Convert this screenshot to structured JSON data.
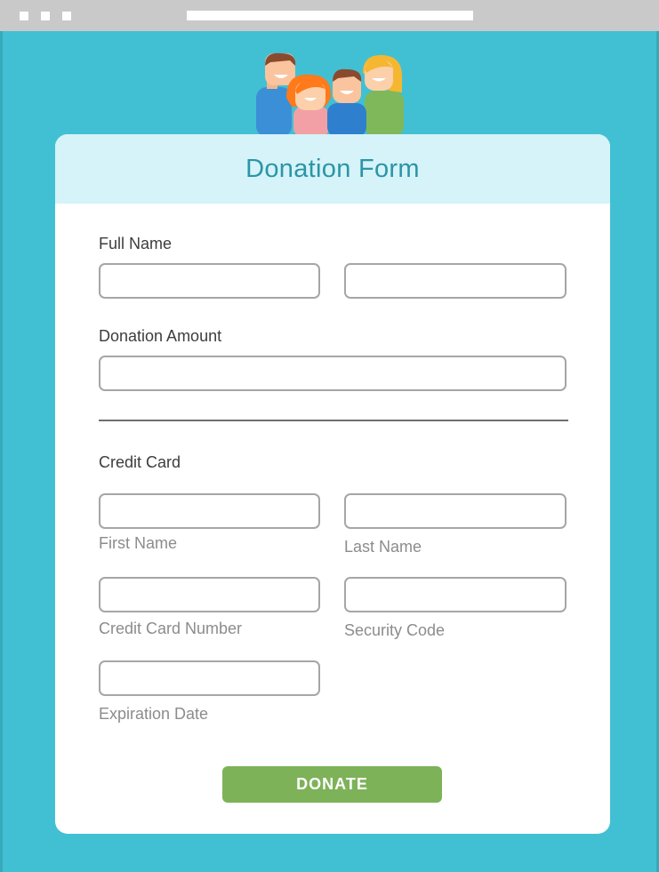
{
  "form": {
    "title": "Donation Form",
    "full_name_label": "Full Name",
    "donation_amount_label": "Donation Amount",
    "credit_card_label": "Credit Card",
    "first_name_label": "First Name",
    "last_name_label": "Last Name",
    "card_number_label": "Credit Card Number",
    "security_code_label": "Security Code",
    "expiration_label": "Expiration Date",
    "donate_label": "DONATE"
  },
  "colors": {
    "background": "#42c0d3",
    "header": "#d5f3f8",
    "title": "#2b95a6",
    "button": "#7db259"
  }
}
